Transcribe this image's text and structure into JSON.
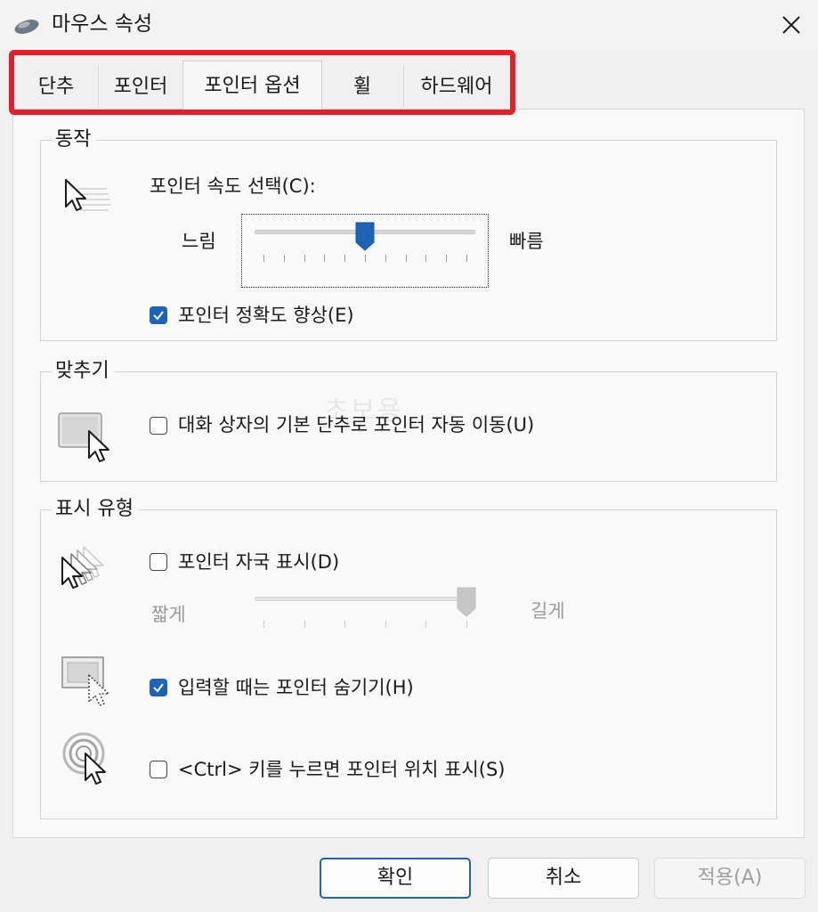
{
  "window": {
    "title": "마우스 속성",
    "app_icon": "mouse-icon",
    "close_icon": "close-icon"
  },
  "tabs": [
    {
      "label": "단추"
    },
    {
      "label": "포인터"
    },
    {
      "label": "포인터 옵션",
      "active": true
    },
    {
      "label": "휠"
    },
    {
      "label": "하드웨어"
    }
  ],
  "highlight_color": "#e51f2a",
  "motion": {
    "title": "동작",
    "speed_label": "포인터 속도 선택(C):",
    "slow_label": "느림",
    "fast_label": "빠름",
    "speed_value_fraction": 0.5,
    "precision_label": "포인터 정확도 향상(E)",
    "precision_checked": true
  },
  "snap_to": {
    "title": "맞추기",
    "default_button_label": "대화 상자의 기본 단추로 포인터 자동 이동(U)",
    "checked": false
  },
  "visibility": {
    "title": "표시 유형",
    "trails_label": "포인터 자국 표시(D)",
    "trails_checked": false,
    "short_label": "짧게",
    "long_label": "길게",
    "trails_value_fraction": 1.0,
    "hide_typing_label": "입력할 때는 포인터 숨기기(H)",
    "hide_typing_checked": true,
    "ctrl_location_label": "<Ctrl> 키를 누르면 포인터 위치 표시(S)",
    "ctrl_location_checked": false
  },
  "watermark": "초보용",
  "buttons": {
    "ok": "확인",
    "cancel": "취소",
    "apply": "적용(A)"
  },
  "accent_color": "#1f63b8"
}
